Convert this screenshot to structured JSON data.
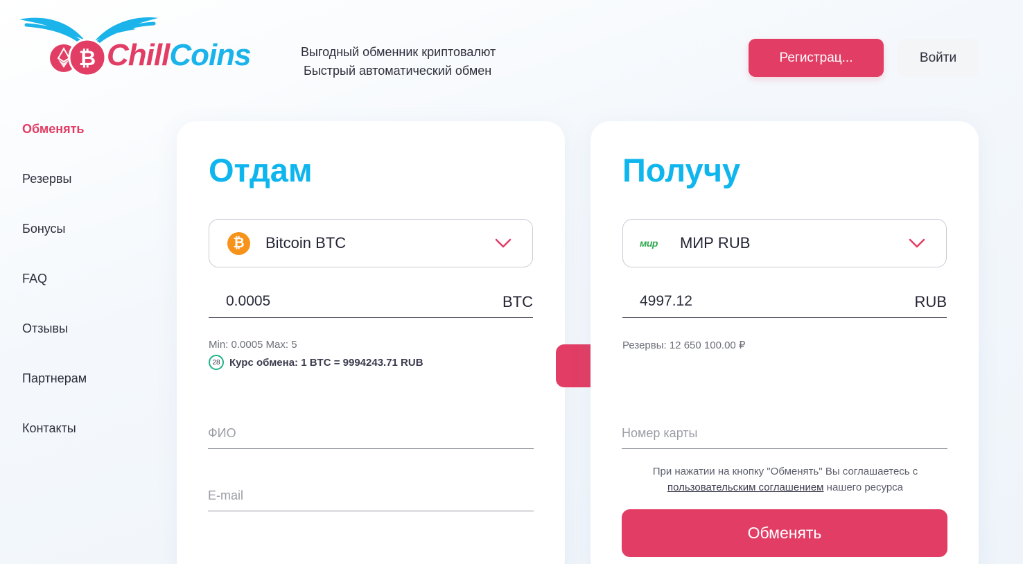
{
  "brand": {
    "name_part1": "Chill",
    "name_part2": "Coins",
    "colors": {
      "primary": "#e23d64",
      "accent": "#1ab3ea",
      "title": "#0fb6ee"
    }
  },
  "header": {
    "tagline_line1": "Выгодный обменник криптовалют",
    "tagline_line2": "Быстрый автоматический обмен",
    "register_label": "Регистрац...",
    "login_label": "Войти"
  },
  "sidebar": {
    "items": [
      {
        "label": "Обменять",
        "active": true
      },
      {
        "label": "Резервы"
      },
      {
        "label": "Бонусы"
      },
      {
        "label": "FAQ"
      },
      {
        "label": "Отзывы"
      },
      {
        "label": "Партнерам"
      },
      {
        "label": "Контакты"
      }
    ]
  },
  "give": {
    "title": "Отдам",
    "currency": {
      "label": "Bitcoin BTC",
      "icon": "bitcoin-icon"
    },
    "amount": "0.0005",
    "unit": "BTC",
    "limits": "Min: 0.0005 Max: 5",
    "timer": "28",
    "rate": "Курс обмена: 1 BTC = 9994243.71 RUB",
    "fio_placeholder": "ФИО",
    "email_placeholder": "E-mail"
  },
  "get": {
    "title": "Получу",
    "currency": {
      "label": "МИР RUB",
      "icon": "mir-icon",
      "icon_text": "мир"
    },
    "amount": "4997.12",
    "unit": "RUB",
    "reserves": "Резервы: 12 650 100.00 ₽",
    "card_placeholder": "Номер карты",
    "agreement_text": "При нажатии на кнопку \"Обменять\" Вы соглашаетесь с",
    "agreement_link": "пользовательским соглашением",
    "agreement_tail": "нашего ресурса",
    "submit_label": "Обменять"
  }
}
